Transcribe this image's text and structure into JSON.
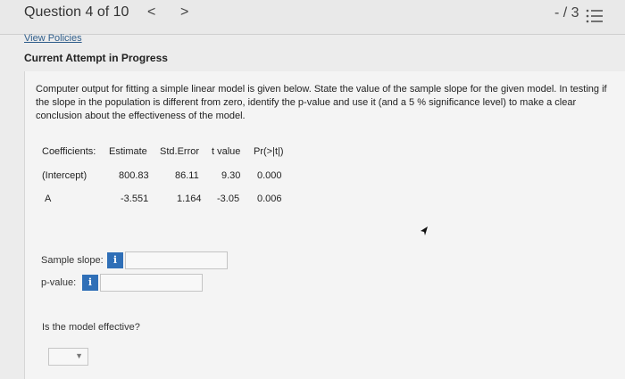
{
  "header": {
    "question_label": "Question 4 of 10",
    "prev_icon": "chevron-left-icon",
    "next_icon": "chevron-right-icon",
    "score": "- / 3",
    "list_icon": "list-icon"
  },
  "policies_link": "View Policies",
  "attempt_title": "Current Attempt in Progress",
  "prompt": "Computer output for fitting a simple linear model is given below. State the value of the sample slope for the given model. In testing if the slope in the population is different from zero, identify the p-value and use it (and a 5 % significance level) to make a clear conclusion about the effectiveness of the model.",
  "table": {
    "headers": [
      "Coefficients:",
      "Estimate",
      "Std.Error",
      "t value",
      "Pr(>|t|)"
    ],
    "rows": [
      [
        "(Intercept)",
        "800.83",
        "86.11",
        "9.30",
        "0.000"
      ],
      [
        "A",
        "-3.551",
        "1.164",
        "-3.05",
        "0.006"
      ]
    ]
  },
  "slope": {
    "label": "Sample slope:",
    "info": "i",
    "value": ""
  },
  "pvalue": {
    "label": "p-value:",
    "info": "i",
    "value": ""
  },
  "effective": {
    "label": "Is the model effective?",
    "selected": ""
  },
  "colors": {
    "info_badge": "#2f6fb7",
    "link": "#2e5d8a"
  }
}
